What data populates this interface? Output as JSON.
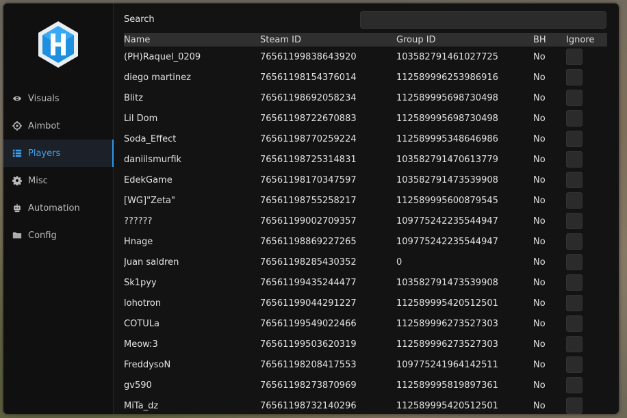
{
  "nav": {
    "items": [
      {
        "label": "Visuals",
        "icon": "eye-icon"
      },
      {
        "label": "Aimbot",
        "icon": "crosshair-icon"
      },
      {
        "label": "Players",
        "icon": "list-icon",
        "active": true
      },
      {
        "label": "Misc",
        "icon": "gear-icon"
      },
      {
        "label": "Automation",
        "icon": "robot-icon"
      },
      {
        "label": "Config",
        "icon": "folder-icon"
      }
    ]
  },
  "search": {
    "label": "Search",
    "value": ""
  },
  "table": {
    "headers": {
      "name": "Name",
      "steam_id": "Steam ID",
      "group_id": "Group ID",
      "bh": "BH",
      "ignore": "Ignore"
    },
    "rows": [
      {
        "name": "(PH)Raquel_0209",
        "steam_id": "76561199838643920",
        "group_id": "103582791461027725",
        "bh": "No"
      },
      {
        "name": "diego martinez",
        "steam_id": "76561198154376014",
        "group_id": "112589996253986916",
        "bh": "No"
      },
      {
        "name": "Blitz",
        "steam_id": "76561198692058234",
        "group_id": "112589995698730498",
        "bh": "No"
      },
      {
        "name": "Lil Dom",
        "steam_id": "76561198722670883",
        "group_id": "112589995698730498",
        "bh": "No"
      },
      {
        "name": "Soda_Effect",
        "steam_id": "76561198770259224",
        "group_id": "112589995348646986",
        "bh": "No"
      },
      {
        "name": "daniilsmurfik",
        "steam_id": "76561198725314831",
        "group_id": "103582791470613779",
        "bh": "No"
      },
      {
        "name": "EdekGame",
        "steam_id": "76561198170347597",
        "group_id": "103582791473539908",
        "bh": "No"
      },
      {
        "name": "[WG]\"Zeta\"",
        "steam_id": "76561198755258217",
        "group_id": "112589995600879545",
        "bh": "No"
      },
      {
        "name": "??????",
        "steam_id": "76561199002709357",
        "group_id": "109775242235544947",
        "bh": "No"
      },
      {
        "name": "Hnage",
        "steam_id": "76561198869227265",
        "group_id": "109775242235544947",
        "bh": "No"
      },
      {
        "name": "Juan saldren",
        "steam_id": "76561198285430352",
        "group_id": "0",
        "bh": "No"
      },
      {
        "name": "Sk1pyy",
        "steam_id": "76561199435244477",
        "group_id": "103582791473539908",
        "bh": "No"
      },
      {
        "name": "lohotron",
        "steam_id": "76561199044291227",
        "group_id": "112589995420512501",
        "bh": "No"
      },
      {
        "name": "COTULa",
        "steam_id": "76561199549022466",
        "group_id": "112589996273527303",
        "bh": "No"
      },
      {
        "name": "Meow:3",
        "steam_id": "76561199503620319",
        "group_id": "112589996273527303",
        "bh": "No"
      },
      {
        "name": "FreddysoN",
        "steam_id": "76561198208417553",
        "group_id": "109775241964142511",
        "bh": "No"
      },
      {
        "name": "gv590",
        "steam_id": "76561198273870969",
        "group_id": "112589995819897361",
        "bh": "No"
      },
      {
        "name": "MiTa_dz",
        "steam_id": "76561198732140296",
        "group_id": "112589995420512501",
        "bh": "No"
      }
    ]
  },
  "colors": {
    "accent": "#3ba3f2",
    "window_bg": "#131313",
    "sidebar_bg": "#101010",
    "header_bg": "#2f2f2f",
    "input_bg": "#2b2b2b"
  }
}
